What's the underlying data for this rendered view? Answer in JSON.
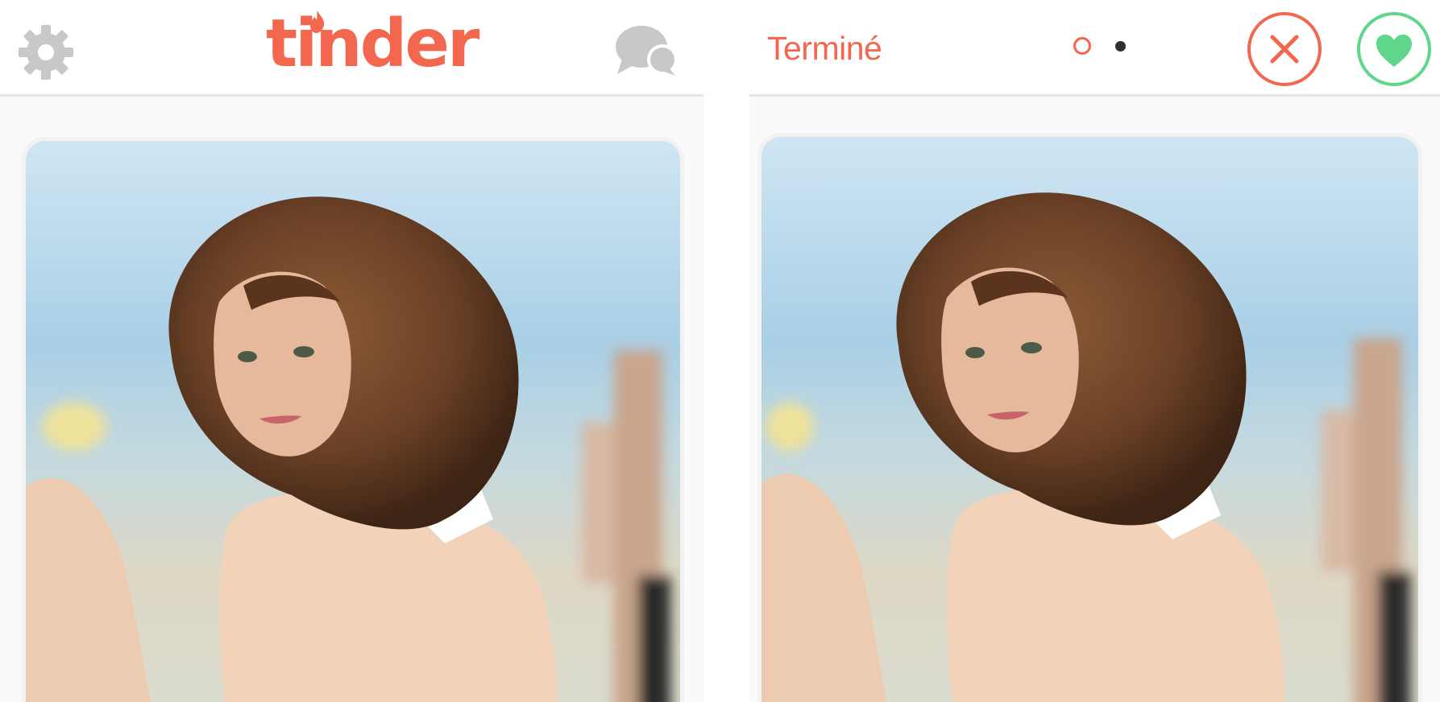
{
  "left_screen": {
    "logo_text": "tinder",
    "icons": {
      "settings": "gear-icon",
      "messages": "chat-bubbles-icon",
      "logo_flame": "flame-icon"
    },
    "card": {
      "photo": "profile-photo-woman-beach"
    }
  },
  "right_screen": {
    "done_label": "Terminé",
    "pager": {
      "current": 1,
      "total": 2
    },
    "icons": {
      "dislike": "close-icon",
      "like": "heart-icon"
    },
    "card": {
      "photo": "profile-photo-woman-beach"
    }
  },
  "colors": {
    "brand": "#f2674d",
    "like_green": "#5fd68b",
    "icon_gray": "#c8c8c8",
    "divider": "#e3e3e3"
  }
}
